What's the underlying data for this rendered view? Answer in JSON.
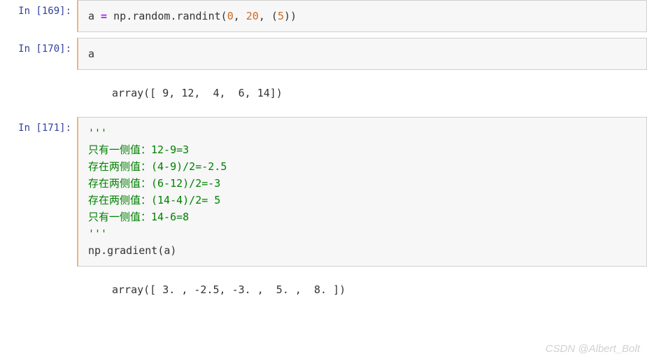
{
  "cells": {
    "c169": {
      "prompt": "In [169]:",
      "code": {
        "a": "a",
        "eq": " = ",
        "np": "np",
        "dot1": ".",
        "random": "random",
        "dot2": ".",
        "randint": "randint",
        "lp": "(",
        "n0": "0",
        "c1": ", ",
        "n20": "20",
        "c2": ", ",
        "lp2": "(",
        "n5": "5",
        "rp2": ")",
        "rp": ")"
      }
    },
    "c170": {
      "prompt": "In [170]:",
      "code": "a",
      "output": "array([ 9, 12,  4,  6, 14])"
    },
    "c171": {
      "prompt": "In [171]:",
      "docq1": "'''",
      "lines": [
        "只有一侧值：12-9=3",
        "存在两侧值：(4-9)/2=-2.5",
        "存在两侧值：(6-12)/2=-3",
        "存在两侧值：(14-4)/2= 5",
        "只有一侧值：14-6=8"
      ],
      "docq2": "'''",
      "call": {
        "np": "np",
        "dot": ".",
        "gradient": "gradient",
        "lp": "(",
        "arg": "a",
        "rp": ")"
      },
      "output": "array([ 3. , -2.5, -3. ,  5. ,  8. ])"
    }
  },
  "watermark": "CSDN @Albert_Bolt",
  "chart_data": {
    "type": "table",
    "input_array": [
      9,
      12,
      4,
      6,
      14
    ],
    "gradient_output": [
      3.0,
      -2.5,
      -3.0,
      5.0,
      8.0
    ],
    "explanations": [
      {
        "desc": "只有一侧值",
        "calc": "12-9=3"
      },
      {
        "desc": "存在两侧值",
        "calc": "(4-9)/2=-2.5"
      },
      {
        "desc": "存在两侧值",
        "calc": "(6-12)/2=-3"
      },
      {
        "desc": "存在两侧值",
        "calc": "(14-4)/2= 5"
      },
      {
        "desc": "只有一侧值",
        "calc": "14-6=8"
      }
    ]
  }
}
